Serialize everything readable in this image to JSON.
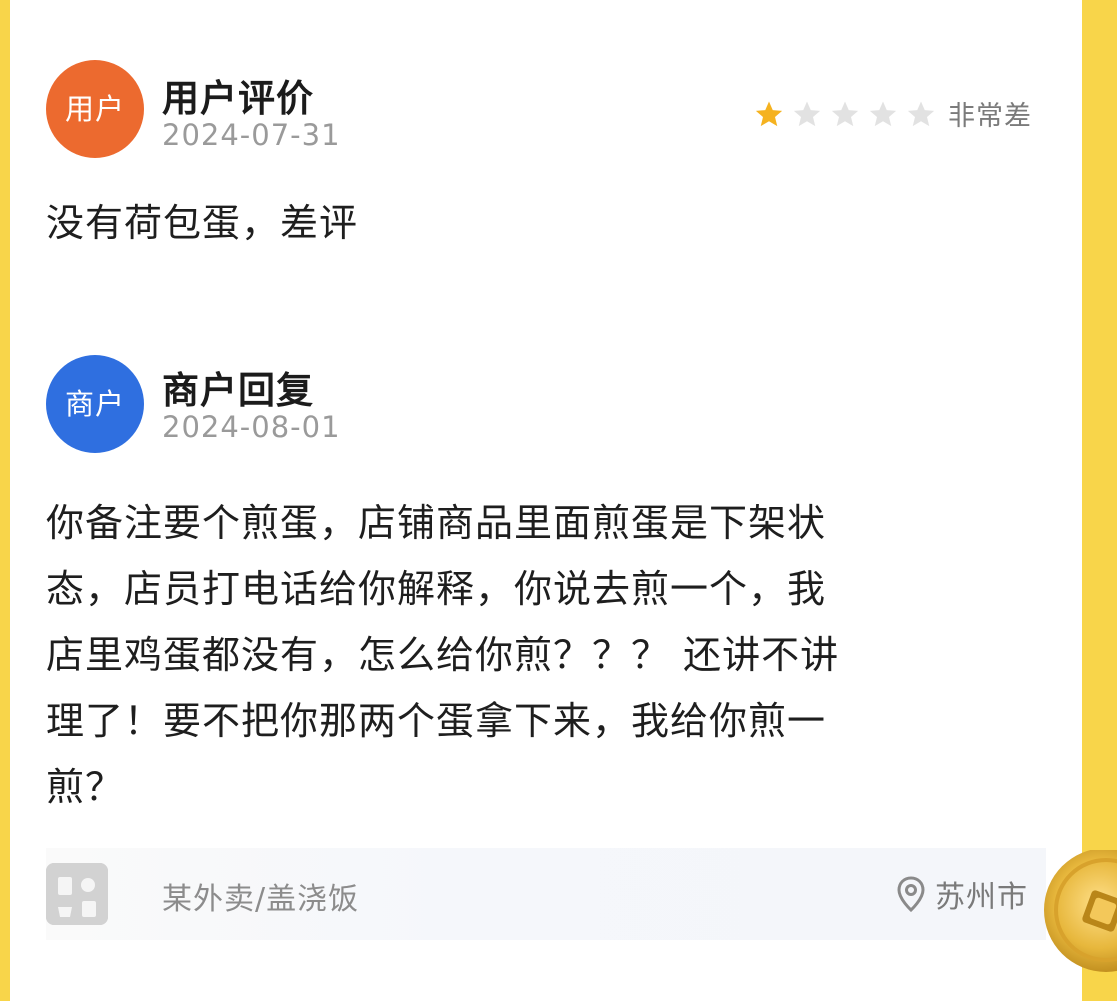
{
  "review": {
    "avatar_label": "用户",
    "author": "用户评价",
    "date": "2024-07-31",
    "rating_value": 1,
    "rating_max": 5,
    "rating_label": "非常差",
    "text": "没有荷包蛋，差评"
  },
  "reply": {
    "avatar_label": "商户",
    "author": "商户回复",
    "date": "2024-08-01",
    "text_lines": [
      "你备注要个煎蛋，店铺商品里面煎蛋是下架状",
      "态，店员打电话给你解释，你说去煎一个，我",
      "店里鸡蛋都没有，怎么给你煎？？？ 还讲不讲",
      "理了！要不把你那两个蛋拿下来，我给你煎一",
      "煎？"
    ]
  },
  "footer": {
    "shop": "某外卖/盖浇饭",
    "location": "苏州市"
  },
  "colors": {
    "user_avatar": "#ec6a2f",
    "merchant_avatar": "#2f6fe0",
    "star_active": "#f5b21f",
    "star_inactive": "#e2e2e2",
    "border": "#f8d54a"
  }
}
